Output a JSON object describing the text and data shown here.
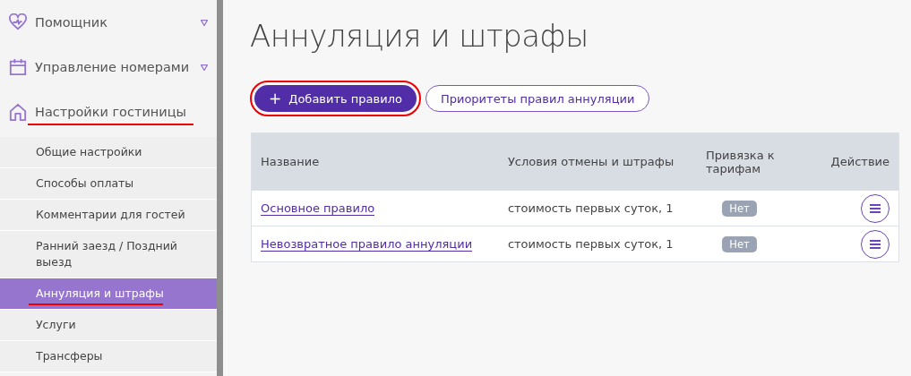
{
  "sidebar": {
    "items": [
      {
        "label": "Помощник",
        "kind": "heart",
        "expandable": true,
        "annotated": false
      },
      {
        "label": "Управление номерами",
        "kind": "calendar",
        "expandable": true,
        "annotated": false
      },
      {
        "label": "Настройки гостиницы",
        "kind": "house",
        "expandable": false,
        "annotated": true
      }
    ],
    "subitems": [
      {
        "label": "Общие настройки",
        "selected": false
      },
      {
        "label": "Способы оплаты",
        "selected": false
      },
      {
        "label": "Комментарии для гостей",
        "selected": false
      },
      {
        "label": "Ранний заезд / Поздний выезд",
        "selected": false
      },
      {
        "label": "Аннуляция и штрафы",
        "selected": true
      },
      {
        "label": "Услуги",
        "selected": false
      },
      {
        "label": "Трансферы",
        "selected": false
      }
    ]
  },
  "page": {
    "title": "Аннуляция и штрафы"
  },
  "buttons": [
    {
      "label": "Добавить правило",
      "kind": "primary",
      "icon": "+",
      "annotated": true
    },
    {
      "label": "Приоритеты правил аннуляции",
      "kind": "outline",
      "annotated": false
    }
  ],
  "table": {
    "columns": [
      "Название",
      "Условия отмены и штрафы",
      "Привязка к тарифам",
      "Действие"
    ],
    "rows": [
      {
        "name": "Основное правило",
        "conditions": "стоимость первых суток, 1",
        "binding": "Нет"
      },
      {
        "name": "Невозвратное правило аннуляции",
        "conditions": "стоимость первых суток, 1",
        "binding": "Нет"
      }
    ]
  }
}
